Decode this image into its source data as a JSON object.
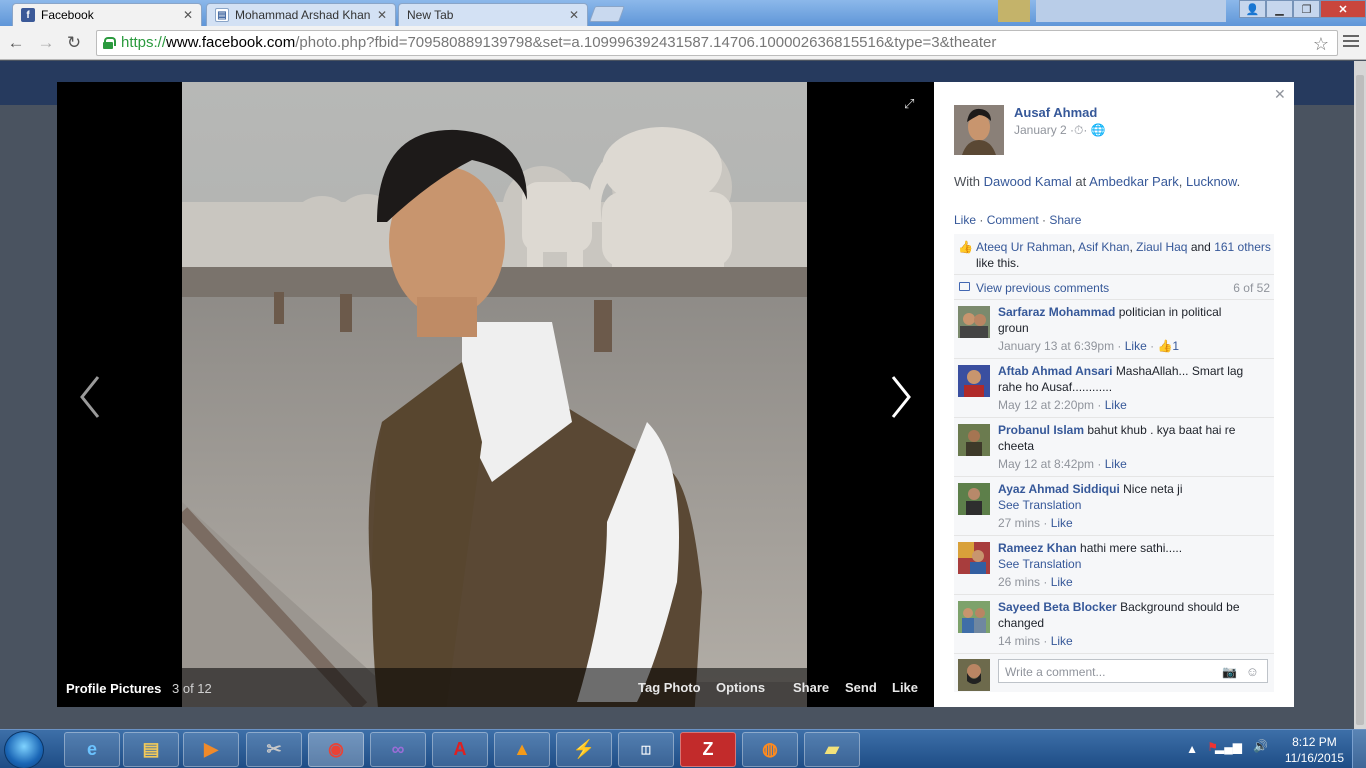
{
  "browser": {
    "tabs": [
      {
        "title": "Facebook",
        "active": true
      },
      {
        "title": "Mohammad Arshad Khan",
        "active": false
      },
      {
        "title": "New Tab",
        "active": false
      }
    ],
    "url": {
      "scheme": "https://",
      "host": "www.facebook.com",
      "rest": "/photo.php?fbid=709580889139798&set=a.109996392431587.14706.100002636815516&type=3&theater"
    }
  },
  "viewer": {
    "album": "Profile Pictures",
    "position": "3 of 12",
    "actions": [
      "Tag Photo",
      "Options",
      "Share",
      "Send",
      "Like"
    ]
  },
  "post": {
    "author": "Ausaf Ahmad",
    "date": "January 2",
    "with_prefix": "With",
    "with_person": "Dawood Kamal",
    "at_word": "at",
    "place": "Ambedkar Park",
    "city": "Lucknow",
    "actions": {
      "like": "Like",
      "comment": "Comment",
      "share": "Share"
    },
    "likes": {
      "names": [
        "Ateeq Ur Rahman",
        "Asif Khan",
        "Ziaul Haq"
      ],
      "and_word": "and",
      "others": "161 others",
      "suffix": "like this."
    },
    "view_previous": "View previous comments",
    "comment_page": "6 of 52",
    "comments": [
      {
        "name": "Sarfaraz Mohammad",
        "text": "politician in political groun",
        "time": "January 13 at 6:39pm",
        "like": "Like",
        "like_count": "1",
        "translate": ""
      },
      {
        "name": "Aftab Ahmad Ansari",
        "text": "MashaAllah... Smart lag rahe ho Ausaf............",
        "time": "May 12 at 2:20pm",
        "like": "Like",
        "like_count": "",
        "translate": ""
      },
      {
        "name": "Probanul Islam",
        "text": "bahut khub . kya baat hai re cheeta",
        "time": "May 12 at 8:42pm",
        "like": "Like",
        "like_count": "",
        "translate": ""
      },
      {
        "name": "Ayaz Ahmad Siddiqui",
        "text": "Nice neta ji",
        "time": "27 mins",
        "like": "Like",
        "like_count": "",
        "translate": "See Translation"
      },
      {
        "name": "Rameez Khan",
        "text": "hathi mere sathi.....",
        "time": "26 mins",
        "like": "Like",
        "like_count": "",
        "translate": "See Translation"
      },
      {
        "name": "Sayeed Beta Blocker",
        "text": "Background should be changed",
        "time": "14 mins",
        "like": "Like",
        "like_count": "",
        "translate": ""
      }
    ],
    "write_placeholder": "Write a comment..."
  },
  "taskbar": {
    "time": "8:12 PM",
    "date": "11/16/2015"
  },
  "colors": {
    "facebook_blue": "#365899",
    "taskbar": "#1e4d86",
    "chrome_frame": "#6ea4e1"
  }
}
